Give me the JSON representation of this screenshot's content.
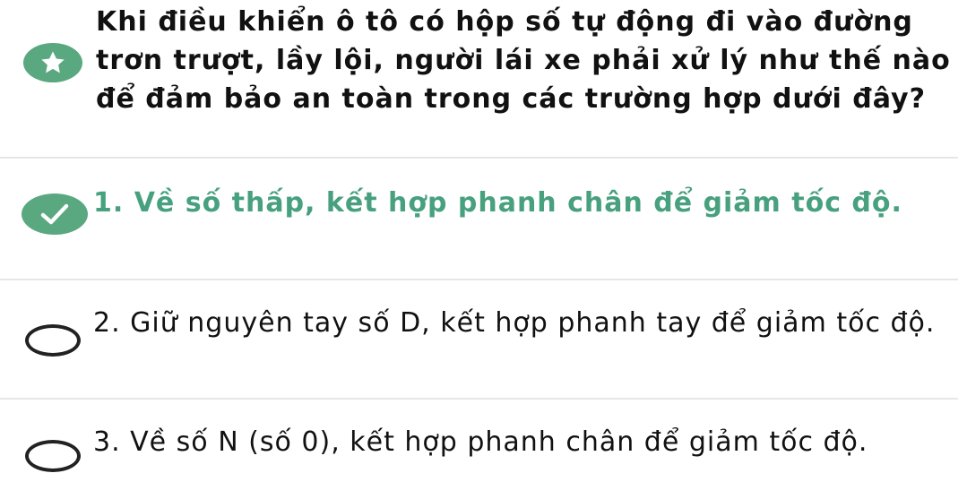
{
  "question": {
    "text": "Khi điều khiển ô tô có hộp số tự động đi vào đường trơn trượt, lầy lội, người lái xe phải xử lý như thế nào để đảm bảo an toàn trong các trường hợp dưới đây?",
    "icon": "star-icon"
  },
  "options": [
    {
      "text": "1. Về số thấp, kết hợp phanh chân để giảm tốc độ.",
      "state": "correct",
      "icon": "checkmark-icon"
    },
    {
      "text": "2. Giữ nguyên tay số D, kết hợp phanh tay để giảm tốc độ.",
      "state": "unselected",
      "icon": "radio-empty-icon"
    },
    {
      "text": "3. Về số N (số 0), kết hợp phanh chân để giảm tốc độ.",
      "state": "unselected",
      "icon": "radio-empty-icon"
    }
  ],
  "colors": {
    "accent": "#5aa880",
    "correct_text": "#47a07e",
    "divider": "#e6e6e6",
    "text": "#111111"
  }
}
